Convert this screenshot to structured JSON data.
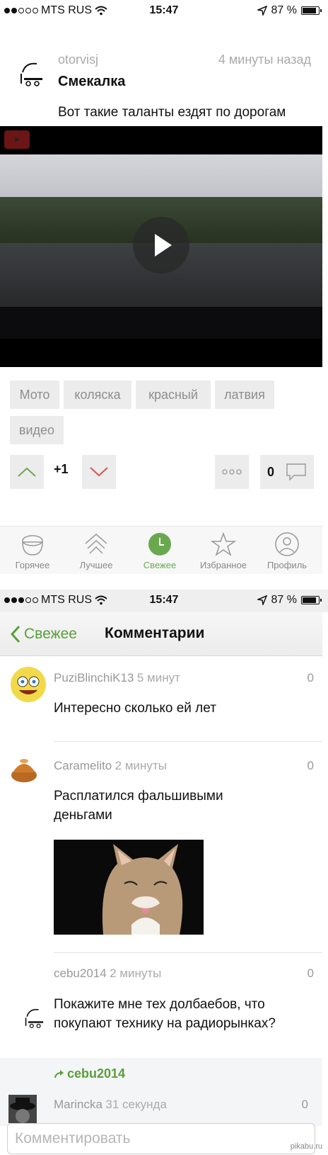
{
  "status_top": {
    "carrier": "MTS RUS",
    "time": "15:47",
    "battery": "87 %"
  },
  "post": {
    "author": "otorvisj",
    "time": "4 минуты назад",
    "title": "Смекалка",
    "description": "Вот такие таланты ездят по дорогам",
    "tags": [
      "Мото",
      "коляска",
      "красный",
      "латвия",
      "видео"
    ],
    "rating": "+1",
    "comments_count": "0"
  },
  "tabbar": {
    "items": [
      {
        "label": "Горячее",
        "icon": "hot-icon"
      },
      {
        "label": "Лучшее",
        "icon": "best-icon"
      },
      {
        "label": "Свежее",
        "icon": "clock-icon"
      },
      {
        "label": "Избранное",
        "icon": "star-icon"
      },
      {
        "label": "Профиль",
        "icon": "profile-icon"
      }
    ],
    "active": "Свежее"
  },
  "status_bottom": {
    "carrier": "MTS RUS",
    "time": "15:47",
    "battery": "87 %"
  },
  "comments_screen": {
    "back_label": "Свежее",
    "title": "Комментарии",
    "comments": [
      {
        "user": "PuziBlinchiK13",
        "time": "5 минут",
        "score": "0",
        "text": "Интересно сколько ей лет"
      },
      {
        "user": "Caramelito",
        "time": "2 минуты",
        "score": "0",
        "text_line1": "Расплатился фальшивыми",
        "text_line2": "деньгами"
      },
      {
        "user": "cebu2014",
        "time": "2 минуты",
        "score": "0",
        "text_line1": "Покажите мне тех долбаебов, что",
        "text_line2": "покупают технику на радиорынках?"
      },
      {
        "reply_to": "cebu2014",
        "user": "Marincka",
        "time": "31 секунда",
        "score": "0"
      }
    ],
    "input_placeholder": "Комментировать"
  },
  "watermark": "pikabu.ru",
  "colors": {
    "accent": "#6aa84f",
    "tag_bg": "#ececec"
  }
}
